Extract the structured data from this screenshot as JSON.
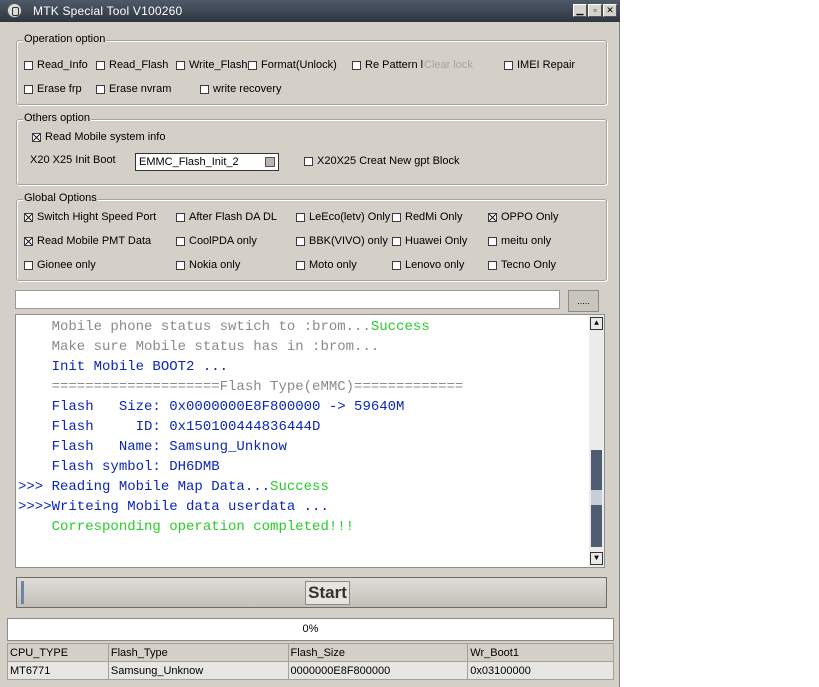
{
  "window": {
    "title": "MTK Special Tool V100260"
  },
  "operation": {
    "label": "Operation option",
    "items": [
      {
        "label": "Read_Info",
        "checked": false,
        "disabled": false
      },
      {
        "label": "Read_Flash",
        "checked": false,
        "disabled": false
      },
      {
        "label": "Write_Flash",
        "checked": false,
        "disabled": false
      },
      {
        "label": "Format(Unlock)",
        "checked": false,
        "disabled": false
      },
      {
        "label": "Re Pattern l",
        "checked": false,
        "disabled": false
      },
      {
        "label": "Clear lock",
        "checked": false,
        "disabled": true
      },
      {
        "label": "IMEI Repair",
        "checked": false,
        "disabled": false
      },
      {
        "label": "Erase frp",
        "checked": false,
        "disabled": false
      },
      {
        "label": "Erase nvram",
        "checked": false,
        "disabled": false
      },
      {
        "label": "write recovery",
        "checked": false,
        "disabled": false
      }
    ]
  },
  "others": {
    "label": "Others option",
    "read_mobile": {
      "label": "Read Mobile system info",
      "checked": true
    },
    "init_boot_label": "X20 X25 Init Boot",
    "init_boot_value": "EMMC_Flash_Init_2",
    "gpt": {
      "label": "X20X25 Creat New gpt Block",
      "checked": false
    }
  },
  "global": {
    "label": "Global Options",
    "items": [
      {
        "label": "Switch Hight Speed Port",
        "checked": true
      },
      {
        "label": "After Flash DA DL",
        "checked": false
      },
      {
        "label": "LeEco(letv) Only",
        "checked": false
      },
      {
        "label": "RedMi Only",
        "checked": false
      },
      {
        "label": "OPPO Only",
        "checked": true
      },
      {
        "label": "Read Mobile PMT Data",
        "checked": true
      },
      {
        "label": "CoolPDA only",
        "checked": false
      },
      {
        "label": "BBK(VIVO) only",
        "checked": false
      },
      {
        "label": "Huawei Only",
        "checked": false
      },
      {
        "label": "meitu only",
        "checked": false
      },
      {
        "label": "Gionee only",
        "checked": false
      },
      {
        "label": "Nokia only",
        "checked": false
      },
      {
        "label": "Moto only",
        "checked": false
      },
      {
        "label": "Lenovo only",
        "checked": false
      },
      {
        "label": "Tecno Only",
        "checked": false
      }
    ]
  },
  "path": {
    "value": "",
    "browse_label": "....."
  },
  "log": [
    [
      {
        "t": "    Mobile phone status swtich to :brom...",
        "c": "gray"
      },
      {
        "t": "Success",
        "c": "green"
      }
    ],
    [
      {
        "t": "    Make sure Mobile status has in :brom...",
        "c": "gray"
      }
    ],
    [
      {
        "t": "    Init Mobile BOOT2 ...",
        "c": "blue"
      }
    ],
    [
      {
        "t": "    ====================Flash Type(eMMC)=============",
        "c": "gray"
      }
    ],
    [
      {
        "t": "    Flash   Size: 0x0000000E8F800000 -> 59640M",
        "c": "blue"
      }
    ],
    [
      {
        "t": "    Flash     ID: 0x150100444836444D",
        "c": "blue"
      }
    ],
    [
      {
        "t": "    Flash   Name: Samsung_Unknow",
        "c": "blue"
      }
    ],
    [
      {
        "t": "    Flash symbol: DH6DMB",
        "c": "blue"
      }
    ],
    [
      {
        "t": ">>> Reading Mobile Map Data...",
        "c": "blue"
      },
      {
        "t": "Success",
        "c": "green"
      }
    ],
    [
      {
        "t": ">>>>Writeing Mobile data userdata ...",
        "c": "blue"
      }
    ],
    [
      {
        "t": "    Corresponding operation completed!!!",
        "c": "green"
      }
    ]
  ],
  "start_label": "Start",
  "progress": {
    "text": "0%",
    "value": 0
  },
  "info_table": {
    "headers": [
      "CPU_TYPE",
      "Flash_Type",
      "Flash_Size",
      "Wr_Boot1"
    ],
    "row": [
      "MT6771",
      "Samsung_Unknow",
      "0000000E8F800000",
      "0x03100000"
    ]
  },
  "colors": {
    "gray": "#8a8a8a",
    "blue": "#0b26b9",
    "green": "#28cc28"
  }
}
